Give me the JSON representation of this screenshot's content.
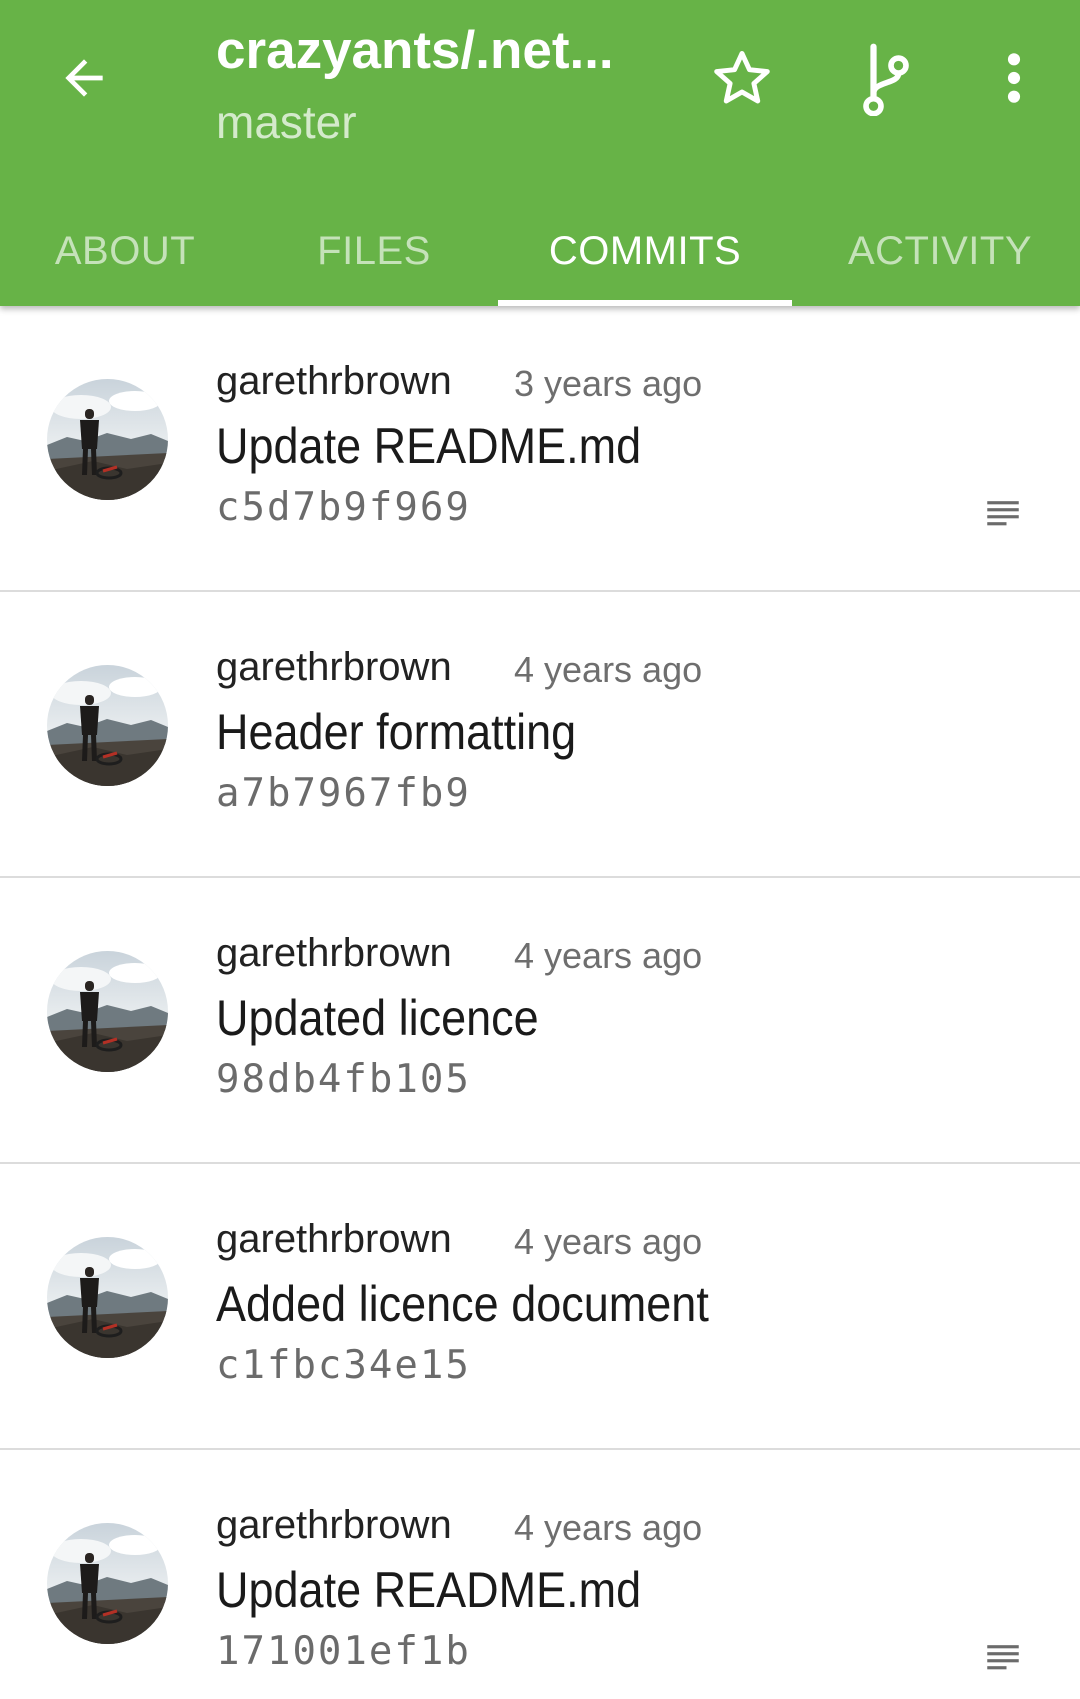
{
  "toolbar": {
    "title": "crazyants/.net...",
    "subtitle": "master",
    "background_color": "#67b347",
    "icons": {
      "back": "arrow-left-icon",
      "star": "star-outline-icon",
      "branch": "source-branch-icon",
      "more": "more-vertical-icon"
    }
  },
  "tabs": [
    {
      "label": "ABOUT",
      "active": false
    },
    {
      "label": "FILES",
      "active": false
    },
    {
      "label": "COMMITS",
      "active": true
    },
    {
      "label": "ACTIVITY",
      "active": false
    }
  ],
  "commits": [
    {
      "author": "garethrbrown",
      "time": "3 years ago",
      "message": "Update README.md",
      "sha": "c5d7b9f969",
      "has_description": true
    },
    {
      "author": "garethrbrown",
      "time": "4 years ago",
      "message": "Header formatting",
      "sha": "a7b7967fb9",
      "has_description": false
    },
    {
      "author": "garethrbrown",
      "time": "4 years ago",
      "message": "Updated licence",
      "sha": "98db4fb105",
      "has_description": false
    },
    {
      "author": "garethrbrown",
      "time": "4 years ago",
      "message": "Added licence document",
      "sha": "c1fbc34e15",
      "has_description": false
    },
    {
      "author": "garethrbrown",
      "time": "4 years ago",
      "message": "Update README.md",
      "sha": "171001ef1b",
      "has_description": true
    }
  ]
}
